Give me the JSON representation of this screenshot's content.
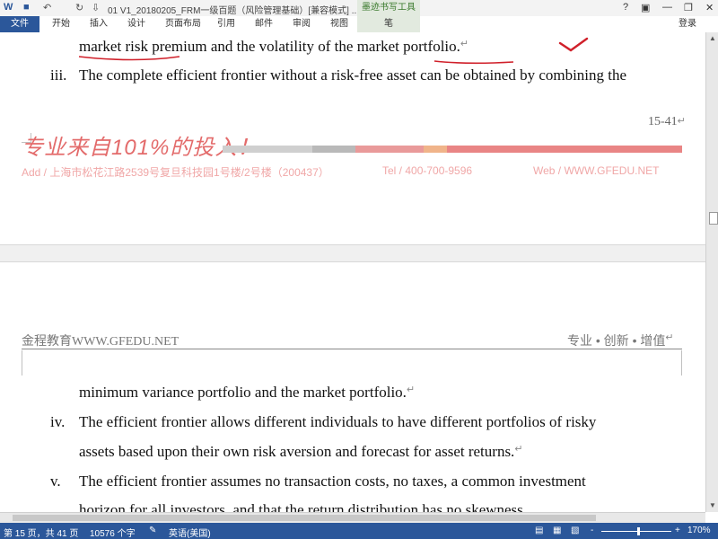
{
  "titlebar": {
    "title": "01 V1_20180205_FRM一级百题（风险管理基础）[兼容模式] ...",
    "context_group": "墨迹书写工具",
    "help": "?",
    "ribbon_display": "▣",
    "minimize": "—",
    "restore": "❐",
    "close": "✕",
    "undo": "↶",
    "redo": "↻",
    "save": "■",
    "customize": "⇩"
  },
  "ribbon": {
    "file": "文件",
    "tabs": [
      "开始",
      "插入",
      "设计",
      "页面布局",
      "引用",
      "邮件",
      "审阅",
      "视图"
    ],
    "context_tab": "笔",
    "login": "登录"
  },
  "document": {
    "line1": "market risk premium and the volatility of the market portfolio.",
    "item3_num": "iii.",
    "item3_line1": "The complete efficient frontier without a risk-free asset can be obtained by combining the",
    "page_number": "15-41",
    "slogan": "专业来自101%的投入！",
    "footer_address": "Add / 上海市松花江路2539号复旦科技园1号楼/2号楼（200437）",
    "footer_tel": "Tel / 400-700-9596",
    "footer_web": "Web / WWW.GFEDU.NET",
    "header_left": "金程教育WWW.GFEDU.NET",
    "header_right": "专业 • 创新 • 增值",
    "item3_line2": "minimum variance portfolio and the market portfolio.",
    "item4_num": "iv.",
    "item4_line1": "The efficient frontier allows different individuals to have different portfolios of risky",
    "item4_line2": "assets based upon their own risk aversion and forecast for asset returns.",
    "item5_num": "v.",
    "item5_line1": "The efficient frontier assumes no transaction costs, no taxes, a common investment",
    "item5_line2": "horizon for all investors, and that the return distribution has no skewness.",
    "para_mark": "↵"
  },
  "statusbar": {
    "page": "第 15 页，共 41 页",
    "words": "10576 个字",
    "language": "英语(美国)",
    "zoom": "170%",
    "zoom_minus": "-",
    "zoom_plus": "+"
  },
  "colors": {
    "accent": "#2b579a",
    "slogan": "#e36b6b",
    "ink": "#d0202a"
  }
}
